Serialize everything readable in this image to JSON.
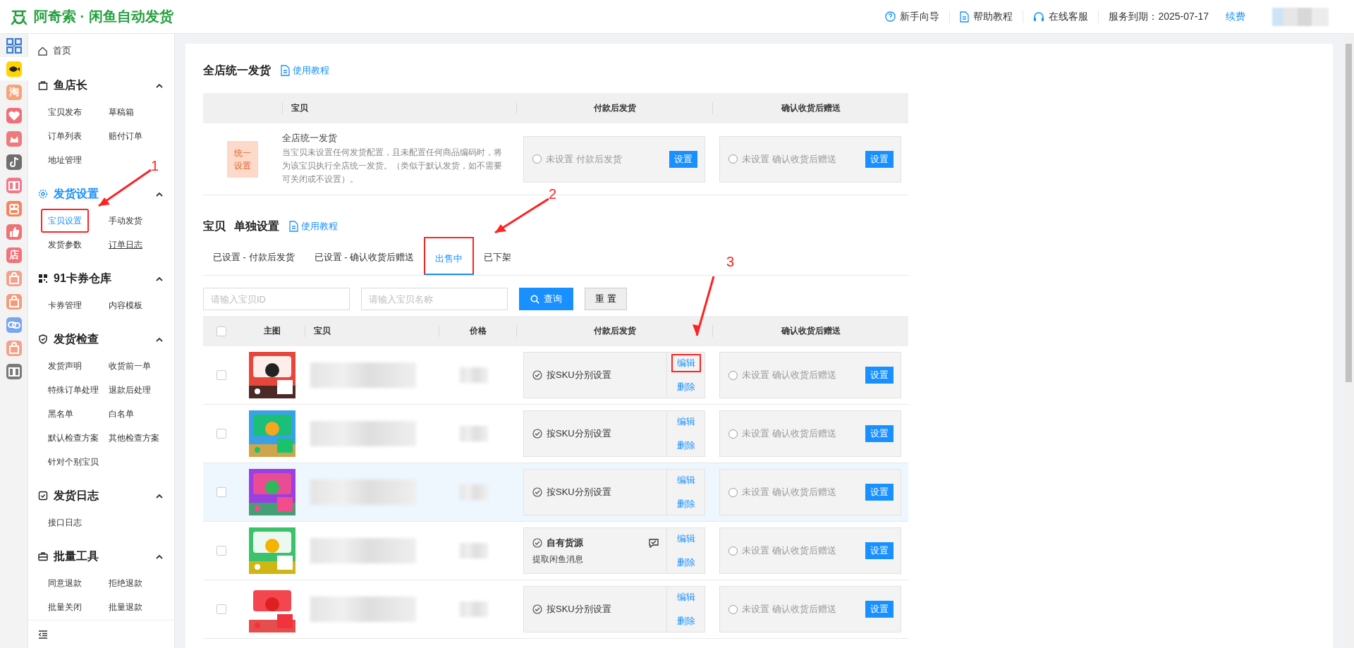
{
  "header": {
    "logo": "阿奇索 · 闲鱼自动发货",
    "links": [
      {
        "label": "新手向导"
      },
      {
        "label": "帮助教程"
      },
      {
        "label": "在线客服"
      }
    ],
    "service": "服务到期：2025-07-17",
    "renew": "续费"
  },
  "app_rail": [
    {
      "kind": "grid",
      "selected": false
    },
    {
      "kind": "fish",
      "color": "#ffd400",
      "selected": true
    },
    {
      "kind": "text",
      "label": "淘",
      "color": "#f5a47a",
      "selected": false
    },
    {
      "kind": "heart",
      "color": "#ef6f7a",
      "selected": false
    },
    {
      "kind": "dog",
      "color": "#ee7b7b",
      "selected": false
    },
    {
      "kind": "note",
      "color": "#6e6e6e",
      "selected": false
    },
    {
      "kind": "book",
      "color": "#f07a8c",
      "selected": false
    },
    {
      "kind": "rings",
      "color": "#f5855e",
      "selected": false
    },
    {
      "kind": "thumb",
      "color": "#f07272",
      "selected": false
    },
    {
      "kind": "text",
      "label": "店",
      "color": "#f0727a",
      "selected": false
    },
    {
      "kind": "bag",
      "color": "#f5a08a",
      "selected": false
    },
    {
      "kind": "bag",
      "color": "#f59a7a",
      "selected": false
    },
    {
      "kind": "link",
      "color": "#7aa5f0",
      "selected": false
    },
    {
      "kind": "bag",
      "color": "#f5a08a",
      "selected": false
    },
    {
      "kind": "book",
      "color": "#7a7a7a",
      "selected": false
    }
  ],
  "sidebar": {
    "home": "首页",
    "sections": [
      {
        "title": "鱼店长",
        "expanded": true,
        "active": false,
        "items": [
          {
            "label": "宝贝发布",
            "selected": false,
            "underlined": false,
            "annotated": false
          },
          {
            "label": "草稿箱",
            "selected": false,
            "underlined": false,
            "annotated": false
          },
          {
            "label": "订单列表",
            "selected": false,
            "underlined": false,
            "annotated": false
          },
          {
            "label": "赔付订单",
            "selected": false,
            "underlined": false,
            "annotated": false
          },
          {
            "label": "地址管理",
            "selected": false,
            "underlined": false,
            "annotated": false
          }
        ]
      },
      {
        "title": "发货设置",
        "expanded": true,
        "active": true,
        "items": [
          {
            "label": "宝贝设置",
            "selected": true,
            "underlined": false,
            "annotated": true
          },
          {
            "label": "手动发货",
            "selected": false,
            "underlined": false,
            "annotated": false
          },
          {
            "label": "发货参数",
            "selected": false,
            "underlined": false,
            "annotated": false
          },
          {
            "label": "订单日志",
            "selected": false,
            "underlined": true,
            "annotated": false
          }
        ]
      },
      {
        "title": "91卡券仓库",
        "expanded": true,
        "active": false,
        "items": [
          {
            "label": "卡券管理",
            "selected": false,
            "underlined": false,
            "annotated": false
          },
          {
            "label": "内容模板",
            "selected": false,
            "underlined": false,
            "annotated": false
          }
        ]
      },
      {
        "title": "发货检查",
        "expanded": true,
        "active": false,
        "items": [
          {
            "label": "发货声明",
            "selected": false,
            "underlined": false,
            "annotated": false
          },
          {
            "label": "收货前一单",
            "selected": false,
            "underlined": false,
            "annotated": false
          },
          {
            "label": "特殊订单处理",
            "selected": false,
            "underlined": false,
            "annotated": false
          },
          {
            "label": "退款后处理",
            "selected": false,
            "underlined": false,
            "annotated": false
          },
          {
            "label": "黑名单",
            "selected": false,
            "underlined": false,
            "annotated": false
          },
          {
            "label": "白名单",
            "selected": false,
            "underlined": false,
            "annotated": false
          },
          {
            "label": "默认检查方案",
            "selected": false,
            "underlined": false,
            "annotated": false
          },
          {
            "label": "其他检查方案",
            "selected": false,
            "underlined": false,
            "annotated": false
          },
          {
            "label": "针对个别宝贝",
            "selected": false,
            "underlined": false,
            "annotated": false
          }
        ]
      },
      {
        "title": "发货日志",
        "expanded": true,
        "active": false,
        "items": [
          {
            "label": "接口日志",
            "selected": false,
            "underlined": false,
            "annotated": false
          }
        ]
      },
      {
        "title": "批量工具",
        "expanded": true,
        "active": false,
        "items": [
          {
            "label": "同意退款",
            "selected": false,
            "underlined": false,
            "annotated": false
          },
          {
            "label": "拒绝退款",
            "selected": false,
            "underlined": false,
            "annotated": false
          },
          {
            "label": "批量关闭",
            "selected": false,
            "underlined": false,
            "annotated": false
          },
          {
            "label": "批量退款",
            "selected": false,
            "underlined": false,
            "annotated": false
          }
        ]
      }
    ]
  },
  "shop_wide": {
    "title": "全店统一发货",
    "tutorial": "使用教程",
    "columns": [
      "宝贝",
      "付款后发货",
      "确认收货后赠送"
    ],
    "badge": "统一设置",
    "name": "全店统一发货",
    "description": "当宝贝未设置任何发货配置，且未配置任何商品编码时，将为该宝贝执行全店统一发货。（类似于默认发货，如不需要可关闭或不设置）。",
    "pay": {
      "status": "未设置 付款后发货",
      "checked": false,
      "button": "设置"
    },
    "confirm": {
      "status": "未设置 确认收货后赠送",
      "checked": false,
      "button": "设置"
    }
  },
  "single": {
    "title_prefix": "宝贝",
    "title": "单独设置",
    "tutorial": "使用教程",
    "tabs": [
      {
        "label": "已设置 - 付款后发货",
        "selected": false,
        "annotated": false
      },
      {
        "label": "已设置 - 确认收货后赠送",
        "selected": false,
        "annotated": false
      },
      {
        "label": "出售中",
        "selected": true,
        "annotated": true
      },
      {
        "label": "已下架",
        "selected": false,
        "annotated": false
      }
    ],
    "search": {
      "id_placeholder": "请输入宝贝ID",
      "name_placeholder": "请输入宝贝名称",
      "query": "查询",
      "reset": "重 置"
    },
    "select_all_checked": false,
    "columns": [
      "主图",
      "宝贝",
      "价格",
      "付款后发货",
      "确认收货后赠送"
    ],
    "rows": [
      {
        "checked": false,
        "highlighted": false,
        "pay": {
          "kind": "sku",
          "status": "按SKU分别设置"
        },
        "edit": "编辑",
        "delete": "删除",
        "edit_annotated": true,
        "confirm": {
          "status": "未设置 确认收货后赠送",
          "checked": false,
          "button": "设置"
        }
      },
      {
        "checked": false,
        "highlighted": false,
        "pay": {
          "kind": "sku",
          "status": "按SKU分别设置"
        },
        "edit": "编辑",
        "delete": "删除",
        "edit_annotated": false,
        "confirm": {
          "status": "未设置 确认收货后赠送",
          "checked": false,
          "button": "设置"
        }
      },
      {
        "checked": false,
        "highlighted": true,
        "pay": {
          "kind": "sku",
          "status": "按SKU分别设置"
        },
        "edit": "编辑",
        "delete": "删除",
        "edit_annotated": false,
        "confirm": {
          "status": "未设置 确认收货后赠送",
          "checked": false,
          "button": "设置"
        }
      },
      {
        "checked": false,
        "highlighted": false,
        "pay": {
          "kind": "own",
          "status": "自有货源",
          "note": "提取闲鱼消息"
        },
        "edit": "编辑",
        "delete": "删除",
        "edit_annotated": false,
        "confirm": {
          "status": "未设置 确认收货后赠送",
          "checked": false,
          "button": "设置"
        }
      },
      {
        "checked": false,
        "highlighted": false,
        "pay": {
          "kind": "sku",
          "status": "按SKU分别设置"
        },
        "edit": "编辑",
        "delete": "删除",
        "edit_annotated": false,
        "confirm": {
          "status": "未设置 确认收货后赠送",
          "checked": false,
          "button": "设置"
        }
      }
    ]
  },
  "annotations": [
    {
      "label": "1"
    },
    {
      "label": "2"
    },
    {
      "label": "3"
    }
  ]
}
